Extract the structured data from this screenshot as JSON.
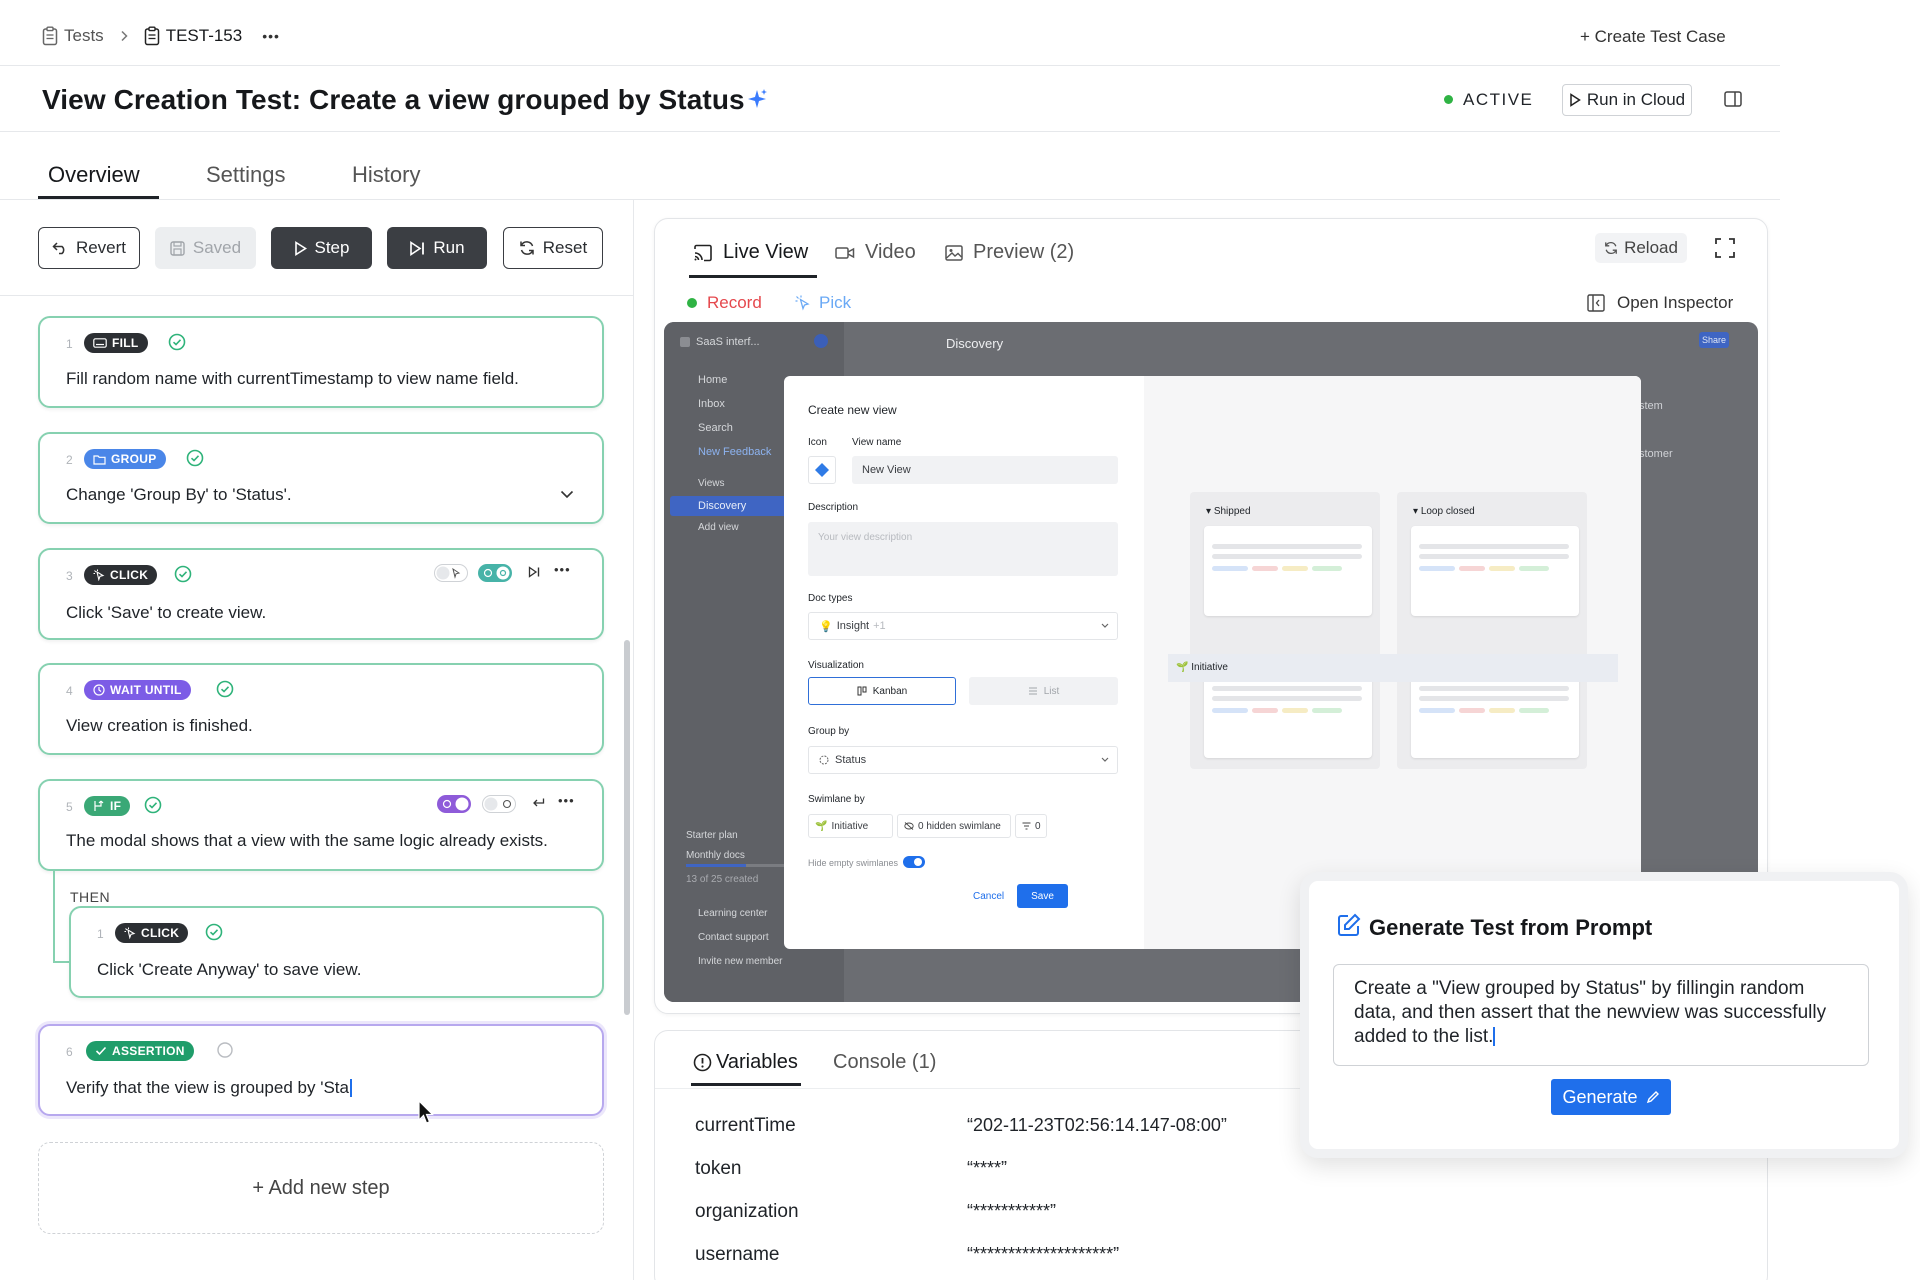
{
  "breadcrumb": {
    "root": "Tests",
    "current": "TEST-153",
    "more": "•••"
  },
  "header": {
    "create_test_case": "+ Create Test Case",
    "title": "View Creation Test: Create a view grouped by Status",
    "status": "ACTIVE",
    "run_in_cloud": "Run in Cloud"
  },
  "tabs": [
    "Overview",
    "Settings",
    "History"
  ],
  "toolbar": {
    "revert": "Revert",
    "saved": "Saved",
    "step": "Step",
    "run": "Run",
    "reset": "Reset"
  },
  "steps": [
    {
      "num": "1",
      "badge": "FILL",
      "desc": "Fill random name with currentTimestamp to view name field."
    },
    {
      "num": "2",
      "badge": "GROUP",
      "desc": "Change 'Group By' to 'Status'."
    },
    {
      "num": "3",
      "badge": "CLICK",
      "desc": "Click 'Save' to create view."
    },
    {
      "num": "4",
      "badge": "WAIT UNTIL",
      "desc": "View creation is finished."
    },
    {
      "num": "5",
      "badge": "IF",
      "desc": "The modal shows that a view with the same logic already exists."
    },
    {
      "num": "1",
      "badge": "CLICK",
      "desc": "Click 'Create Anyway' to save view."
    },
    {
      "num": "6",
      "badge": "ASSERTION",
      "desc": "Verify that the view is grouped by 'Sta"
    }
  ],
  "then_label": "THEN",
  "add_step": "+ Add new step",
  "preview": {
    "tabs": [
      "Live View",
      "Video",
      "Preview (2)"
    ],
    "reload": "Reload",
    "record": "Record",
    "pick": "Pick",
    "open_inspector": "Open Inspector"
  },
  "app": {
    "workspace": "SaaS interf...",
    "nav": [
      "Home",
      "Inbox",
      "Search",
      "New Feedback",
      "Views",
      "Discovery",
      "Add view"
    ],
    "header": "Discovery",
    "share": "Share",
    "side_right": [
      "stem",
      "stomer"
    ],
    "plan": "Starter plan",
    "monthly": "Monthly docs",
    "created": "13 of 25 created",
    "footer": [
      "Learning center",
      "Contact support",
      "Invite new member"
    ]
  },
  "modal": {
    "title": "Create new view",
    "icon_label": "Icon",
    "view_name_label": "View name",
    "view_name_value": "New View",
    "description_label": "Description",
    "description_placeholder": "Your view description",
    "doc_types_label": "Doc types",
    "doc_types_value": "Insight",
    "doc_types_extra": "+1",
    "visualization_label": "Visualization",
    "kanban": "Kanban",
    "list": "List",
    "group_by_label": "Group by",
    "group_by_value": "Status",
    "swimlane_label": "Swimlane by",
    "swimlane_value": "Initiative",
    "hidden_swimlane": "0 hidden swimlane",
    "filter_count": "0",
    "hide_empty": "Hide empty swimlanes",
    "cancel": "Cancel",
    "save": "Save",
    "col1": "Shipped",
    "col2": "Loop closed",
    "swimlane_row": "Initiative"
  },
  "vars": {
    "tabs": [
      "Variables",
      "Console (1)"
    ],
    "rows": [
      {
        "key": "currentTime",
        "value": "“202-11-23T02:56:14.147-08:00”"
      },
      {
        "key": "token",
        "value": "“****”"
      },
      {
        "key": "organization",
        "value": "“***********”"
      },
      {
        "key": "username",
        "value": "“********************”"
      }
    ]
  },
  "generate": {
    "title": "Generate Test from Prompt",
    "prompt": "Create a \"View grouped by Status\" by fillingin random data, and then assert that the newview was successfully added to the list.",
    "button": "Generate"
  },
  "colors": {
    "accent_blue": "#1f6feb",
    "step_border": "#86d1b0",
    "active_green": "#2fb344",
    "badge_dark": "#2c2f33",
    "badge_group": "#4a86e8",
    "badge_wait": "#7c5ce6",
    "badge_if": "#3aa876",
    "badge_assert": "#1f9d6a"
  }
}
